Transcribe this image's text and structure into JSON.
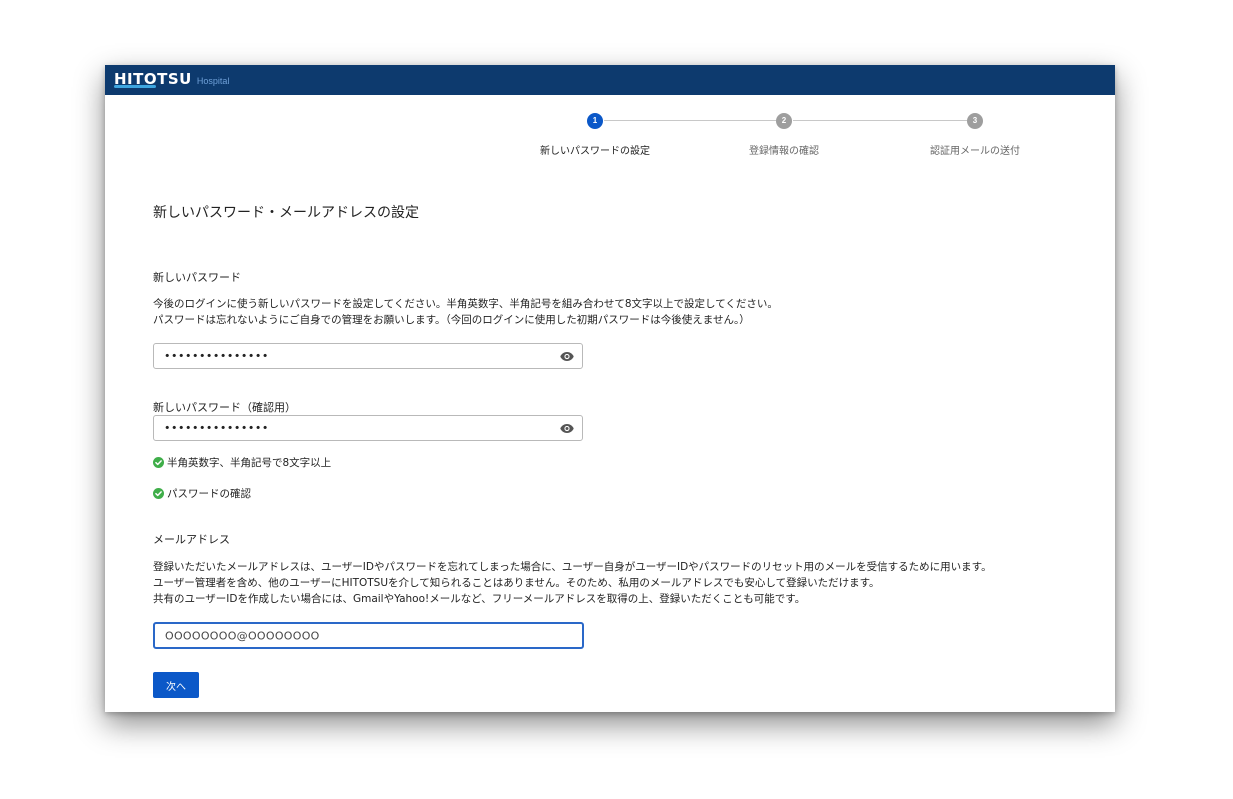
{
  "header": {
    "brand": "HITOTSU",
    "brand_sub": "Hospital"
  },
  "stepper": {
    "steps": [
      {
        "number": "1",
        "label": "新しいパスワードの設定"
      },
      {
        "number": "2",
        "label": "登録情報の確認"
      },
      {
        "number": "3",
        "label": "認証用メールの送付"
      }
    ],
    "active_index": 0
  },
  "page": {
    "title": "新しいパスワード・メールアドレスの設定"
  },
  "password": {
    "label": "新しいパスワード",
    "help_line1": "今後のログインに使う新しいパスワードを設定してください。半角英数字、半角記号を組み合わせて8文字以上で設定してください。",
    "help_line2": "パスワードは忘れないようにご自身での管理をお願いします。（今回のログインに使用した初期パスワードは今後使えません。）",
    "value": "•••••••••••••••"
  },
  "password_confirm": {
    "label": "新しいパスワード（確認用）",
    "value": "•••••••••••••••"
  },
  "validation": {
    "rule1": "半角英数字、半角記号で8文字以上",
    "rule2": "パスワードの確認"
  },
  "email": {
    "label": "メールアドレス",
    "help_line1": "登録いただいたメールアドレスは、ユーザーIDやパスワードを忘れてしまった場合に、ユーザー自身がユーザーIDやパスワードのリセット用のメールを受信するために用います。",
    "help_line2": "ユーザー管理者を含め、他のユーザーにHITOTSUを介して知られることはありません。そのため、私用のメールアドレスでも安心して登録いただけます。",
    "help_line3": "共有のユーザーIDを作成したい場合には、GmailやYahoo!メールなど、フリーメールアドレスを取得の上、登録いただくことも可能です。",
    "value": "OOOOOOOO@OOOOOOOO"
  },
  "actions": {
    "next_label": "次へ"
  },
  "colors": {
    "header_bg": "#0d3a6e",
    "primary": "#0b58c8",
    "check_green": "#3fae49",
    "step_idle": "#9e9e9e"
  }
}
